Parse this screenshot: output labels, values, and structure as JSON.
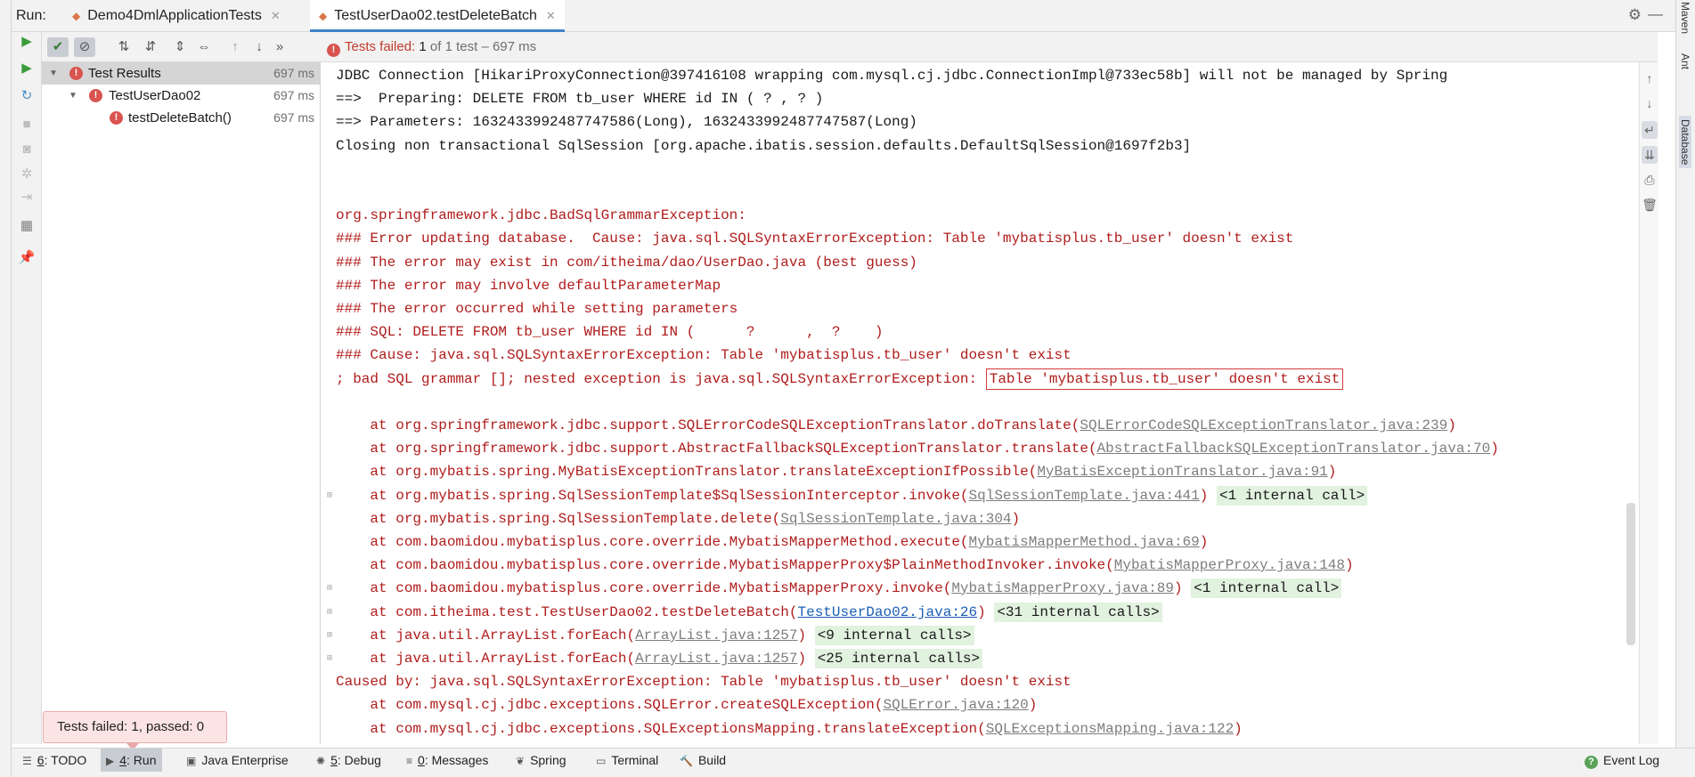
{
  "header": {
    "run_label": "Run:",
    "tabs": [
      {
        "label": "Demo4DmlApplicationTests",
        "icon": "junit-icon",
        "active": false
      },
      {
        "label": "TestUserDao02.testDeleteBatch",
        "icon": "junit-icon",
        "active": true
      }
    ]
  },
  "status": {
    "failed_text": "Tests failed:",
    "count_text": "1",
    "rest_text": "of 1 test – 697 ms"
  },
  "tree": [
    {
      "label": "Test Results",
      "time": "697 ms",
      "level": 0
    },
    {
      "label": "TestUserDao02",
      "time": "697 ms",
      "level": 1
    },
    {
      "label": "testDeleteBatch()",
      "time": "697 ms",
      "level": 2
    }
  ],
  "console": {
    "lines": [
      {
        "type": "normal",
        "parts": [
          {
            "text": "JDBC Connection [HikariProxyConnection@397416108 wrapping com.mysql.cj.jdbc.ConnectionImpl@733ec58b] will not be managed by Spring",
            "style": "normal"
          }
        ]
      },
      {
        "type": "normal",
        "parts": [
          {
            "text": "==>  Preparing: DELETE FROM tb_user WHERE id IN ( ? , ? )",
            "style": "normal"
          }
        ]
      },
      {
        "type": "normal",
        "parts": [
          {
            "text": "==> Parameters: 1632433992487747586(Long), 1632433992487747587(Long)",
            "style": "normal"
          }
        ]
      },
      {
        "type": "normal",
        "parts": [
          {
            "text": "Closing non transactional SqlSession [org.apache.ibatis.session.defaults.DefaultSqlSession@1697f2b3]",
            "style": "normal"
          }
        ]
      },
      {
        "type": "blank",
        "parts": []
      },
      {
        "type": "blank",
        "parts": []
      },
      {
        "type": "error",
        "parts": [
          {
            "text": "org.springframework.jdbc.BadSqlGrammarException:",
            "style": "error"
          }
        ]
      },
      {
        "type": "error",
        "parts": [
          {
            "text": "### Error updating database.  Cause: java.sql.SQLSyntaxErrorException: Table 'mybatisplus.tb_user' doesn't exist",
            "style": "error"
          }
        ]
      },
      {
        "type": "error",
        "parts": [
          {
            "text": "### The error may exist in com/itheima/dao/UserDao.java (best guess)",
            "style": "error"
          }
        ]
      },
      {
        "type": "error",
        "parts": [
          {
            "text": "### The error may involve defaultParameterMap",
            "style": "error"
          }
        ]
      },
      {
        "type": "error",
        "parts": [
          {
            "text": "### The error occurred while setting parameters",
            "style": "error"
          }
        ]
      },
      {
        "type": "error",
        "parts": [
          {
            "text": "### SQL: DELETE FROM tb_user WHERE id IN (      ?      ,  ?    )",
            "style": "error"
          }
        ]
      },
      {
        "type": "error",
        "parts": [
          {
            "text": "### Cause: java.sql.SQLSyntaxErrorException: Table 'mybatisplus.tb_user' doesn't exist",
            "style": "error"
          }
        ]
      },
      {
        "type": "error",
        "parts": [
          {
            "text": "; bad SQL grammar []; nested exception is java.sql.SQLSyntaxErrorException: ",
            "style": "error"
          },
          {
            "text": "Table 'mybatisplus.tb_user' doesn't exist",
            "style": "error boxed"
          }
        ]
      },
      {
        "type": "blank",
        "parts": []
      },
      {
        "type": "error",
        "parts": [
          {
            "text": "    at org.springframework.jdbc.support.SQLErrorCodeSQLExceptionTranslator.doTranslate(",
            "style": "error"
          },
          {
            "text": "SQLErrorCodeSQLExceptionTranslator.java:239",
            "style": "link"
          },
          {
            "text": ")",
            "style": "error"
          }
        ]
      },
      {
        "type": "error",
        "parts": [
          {
            "text": "    at org.springframework.jdbc.support.AbstractFallbackSQLExceptionTranslator.translate(",
            "style": "error"
          },
          {
            "text": "AbstractFallbackSQLExceptionTranslator.java:70",
            "style": "link"
          },
          {
            "text": ")",
            "style": "error"
          }
        ]
      },
      {
        "type": "error",
        "parts": [
          {
            "text": "    at org.mybatis.spring.MyBatisExceptionTranslator.translateExceptionIfPossible(",
            "style": "error"
          },
          {
            "text": "MyBatisExceptionTranslator.java:91",
            "style": "link"
          },
          {
            "text": ")",
            "style": "error"
          }
        ]
      },
      {
        "type": "error",
        "fold": true,
        "parts": [
          {
            "text": "    at org.mybatis.spring.SqlSessionTemplate$SqlSessionInterceptor.invoke(",
            "style": "error"
          },
          {
            "text": "SqlSessionTemplate.java:441",
            "style": "link"
          },
          {
            "text": ") ",
            "style": "error"
          },
          {
            "text": "<1 internal call>",
            "style": "internal"
          }
        ]
      },
      {
        "type": "error",
        "parts": [
          {
            "text": "    at org.mybatis.spring.SqlSessionTemplate.delete(",
            "style": "error"
          },
          {
            "text": "SqlSessionTemplate.java:304",
            "style": "link"
          },
          {
            "text": ")",
            "style": "error"
          }
        ]
      },
      {
        "type": "error",
        "parts": [
          {
            "text": "    at com.baomidou.mybatisplus.core.override.MybatisMapperMethod.execute(",
            "style": "error"
          },
          {
            "text": "MybatisMapperMethod.java:69",
            "style": "link"
          },
          {
            "text": ")",
            "style": "error"
          }
        ]
      },
      {
        "type": "error",
        "parts": [
          {
            "text": "    at com.baomidou.mybatisplus.core.override.MybatisMapperProxy$PlainMethodInvoker.invoke(",
            "style": "error"
          },
          {
            "text": "MybatisMapperProxy.java:148",
            "style": "link"
          },
          {
            "text": ")",
            "style": "error"
          }
        ]
      },
      {
        "type": "error",
        "fold": true,
        "parts": [
          {
            "text": "    at com.baomidou.mybatisplus.core.override.MybatisMapperProxy.invoke(",
            "style": "error"
          },
          {
            "text": "MybatisMapperProxy.java:89",
            "style": "link"
          },
          {
            "text": ") ",
            "style": "error"
          },
          {
            "text": "<1 internal call>",
            "style": "internal"
          }
        ]
      },
      {
        "type": "error",
        "fold": true,
        "parts": [
          {
            "text": "    at com.itheima.test.TestUserDao02.testDeleteBatch(",
            "style": "error"
          },
          {
            "text": "TestUserDao02.java:26",
            "style": "link blue"
          },
          {
            "text": ") ",
            "style": "error"
          },
          {
            "text": "<31 internal calls>",
            "style": "internal"
          }
        ]
      },
      {
        "type": "error",
        "fold": true,
        "parts": [
          {
            "text": "    at java.util.ArrayList.forEach(",
            "style": "error"
          },
          {
            "text": "ArrayList.java:1257",
            "style": "link"
          },
          {
            "text": ") ",
            "style": "error"
          },
          {
            "text": "<9 internal calls>",
            "style": "internal"
          }
        ]
      },
      {
        "type": "error",
        "fold": true,
        "parts": [
          {
            "text": "    at java.util.ArrayList.forEach(",
            "style": "error"
          },
          {
            "text": "ArrayList.java:1257",
            "style": "link"
          },
          {
            "text": ") ",
            "style": "error"
          },
          {
            "text": "<25 internal calls>",
            "style": "internal"
          }
        ]
      },
      {
        "type": "error",
        "parts": [
          {
            "text": "Caused by: java.sql.SQLSyntaxErrorException: Table 'mybatisplus.tb_user' doesn't exist",
            "style": "error"
          }
        ]
      },
      {
        "type": "error",
        "parts": [
          {
            "text": "    at com.mysql.cj.jdbc.exceptions.SQLError.createSQLException(",
            "style": "error"
          },
          {
            "text": "SQLError.java:120",
            "style": "link"
          },
          {
            "text": ")",
            "style": "error"
          }
        ]
      },
      {
        "type": "error",
        "parts": [
          {
            "text": "    at com.mysql.cj.jdbc.exceptions.SQLExceptionsMapping.translateException(",
            "style": "error"
          },
          {
            "text": "SQLExceptionsMapping.java:122",
            "style": "link"
          },
          {
            "text": ")",
            "style": "error"
          }
        ]
      }
    ]
  },
  "tooltip": {
    "text": "Tests failed: 1, passed: 0"
  },
  "bottom_bar": {
    "items": [
      {
        "key": "6",
        "label": ": TODO",
        "icon": "list-icon",
        "active": false
      },
      {
        "key": "4",
        "label": ": Run",
        "icon": "run-icon",
        "active": true
      },
      {
        "key": "",
        "label": "Java Enterprise",
        "icon": "java-enterprise-icon",
        "active": false
      },
      {
        "key": "5",
        "label": ": Debug",
        "icon": "debug-icon",
        "active": false
      },
      {
        "key": "0",
        "label": ": Messages",
        "icon": "messages-icon",
        "active": false
      },
      {
        "key": "",
        "label": "Spring",
        "icon": "spring-icon",
        "active": false
      },
      {
        "key": "",
        "label": "Terminal",
        "icon": "terminal-icon",
        "active": false
      },
      {
        "key": "",
        "label": "Build",
        "icon": "build-icon",
        "active": false
      }
    ],
    "event_log": "Event Log"
  },
  "right_strip": {
    "maven": "Maven",
    "ant": "Ant",
    "database": "Database"
  },
  "colors": {
    "error_text": "#b01c1c",
    "failed_badge": "#d9534f",
    "internal_calls_bg": "#e1f2df",
    "selection": "#d5d5d5",
    "active_tab_underline": "#4083c9"
  }
}
